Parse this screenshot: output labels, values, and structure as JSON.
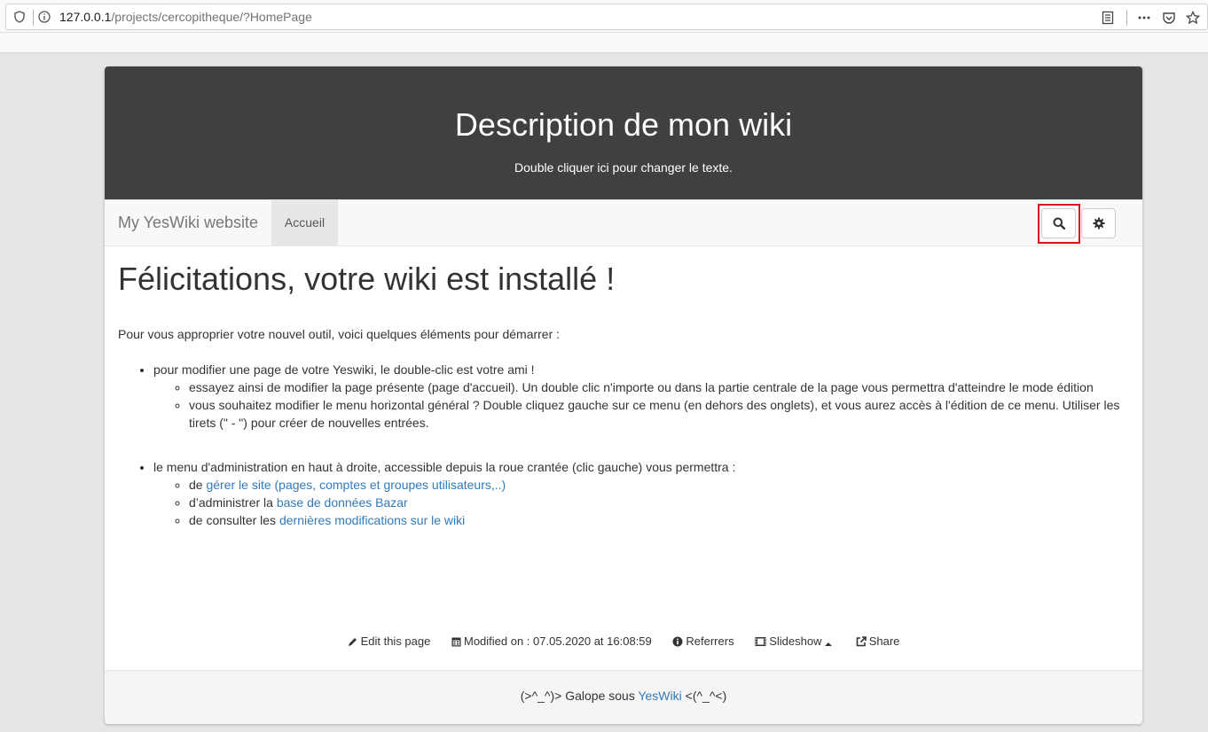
{
  "browser": {
    "url_host": "127.0.0.1",
    "url_path": "/projects/cercopitheque/?HomePage"
  },
  "banner": {
    "title": "Description de mon wiki",
    "subtitle": "Double cliquer ici pour changer le texte."
  },
  "navbar": {
    "brand": "My YesWiki website",
    "active_tab": "Accueil"
  },
  "content": {
    "heading": "Félicitations, votre wiki est installé !",
    "intro": "Pour vous approprier votre nouvel outil, voici quelques éléments pour démarrer :",
    "item1": "pour modifier une page de votre Yeswiki, le double-clic est votre ami !",
    "item1_sub1": "essayez ainsi de modifier la page présente (page d'accueil). Un double clic n'importe ou dans la partie centrale de la page vous permettra d'atteindre le mode édition",
    "item1_sub2": "vous souhaitez modifier le menu horizontal général ? Double cliquez gauche sur ce menu (en dehors des onglets), et vous aurez accès à l'édition de ce menu. Utiliser les tirets (\" - \") pour créer de nouvelles entrées.",
    "item2": "le menu d'administration en haut à droite, accessible depuis la roue crantée (clic gauche) vous permettra :",
    "item2_sub1_prefix": "de ",
    "item2_sub1_link": "gérer le site (pages, comptes et groupes utilisateurs,..)",
    "item2_sub2_prefix": "d’administrer la ",
    "item2_sub2_link": "base de données Bazar",
    "item2_sub3_prefix": "de consulter les ",
    "item2_sub3_link": "dernières modifications sur le wiki"
  },
  "footer": {
    "edit": "Edit this page",
    "modified": "Modified on : 07.05.2020 at 16:08:59",
    "referrers": "Referrers",
    "slideshow": "Slideshow",
    "share": "Share",
    "credit_prefix": "(>^_^)> Galope sous ",
    "credit_link": "YesWiki",
    "credit_suffix": " <(^_^<)"
  }
}
